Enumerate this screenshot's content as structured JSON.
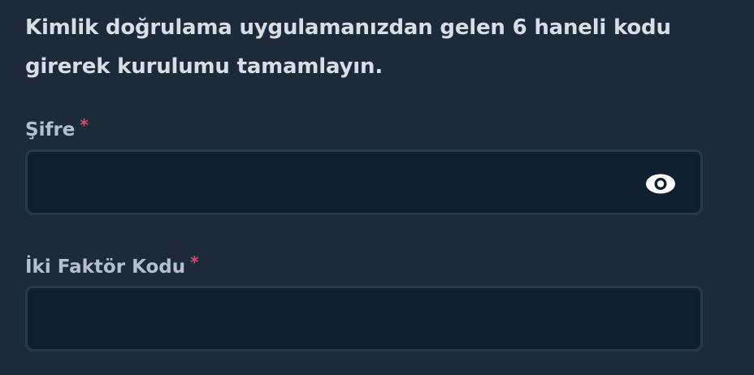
{
  "instruction": {
    "line1": "Kimlik doğrulama uygulamanızdan gelen 6 haneli kodu",
    "line2": "girerek kurulumu tamamlayın."
  },
  "fields": {
    "password": {
      "label": "Şifre",
      "required_mark": "*",
      "value": "",
      "visibility_icon": "eye-icon"
    },
    "two_factor": {
      "label": "İki Faktör Kodu",
      "required_mark": "*",
      "value": ""
    }
  },
  "colors": {
    "background": "#1d2b38",
    "input_background": "#0f1f2d",
    "input_border": "#2b3a48",
    "required": "#e0476a",
    "text": "#d7dee8"
  }
}
